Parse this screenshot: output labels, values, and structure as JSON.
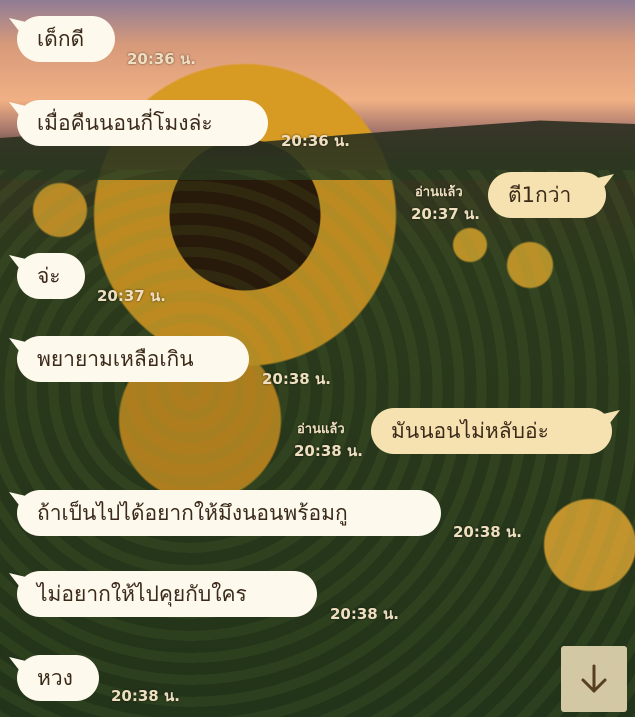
{
  "messages": [
    {
      "text": "เด็กดี",
      "time": "20:36 น.",
      "direction": "in"
    },
    {
      "text": "เมื่อคืนนอนกี่โมงล่ะ",
      "time": "20:36 น.",
      "direction": "in"
    },
    {
      "text": "ตี1กว่า",
      "time": "20:37 น.",
      "read": "อ่านแล้ว",
      "direction": "out"
    },
    {
      "text": "จ่ะ",
      "time": "20:37 น.",
      "direction": "in"
    },
    {
      "text": "พยายามเหลือเกิน",
      "time": "20:38 น.",
      "direction": "in"
    },
    {
      "text": "มันนอนไม่หลับอ่ะ",
      "time": "20:38 น.",
      "read": "อ่านแล้ว",
      "direction": "out"
    },
    {
      "text": "ถ้าเป็นไปได้อยากให้มึงนอนพร้อมกู",
      "time": "20:38 น.",
      "direction": "in"
    },
    {
      "text": "ไม่อยากให้ไปคุยกับใคร",
      "time": "20:38 น.",
      "direction": "in"
    },
    {
      "text": "หวง",
      "time": "20:38 น.",
      "direction": "in"
    }
  ],
  "icons": {
    "scroll_down": "arrow-down-icon"
  },
  "colors": {
    "incoming_bubble": "#fdf9ec",
    "outgoing_bubble": "#f6e2b0",
    "timestamp": "#efdfc0"
  }
}
